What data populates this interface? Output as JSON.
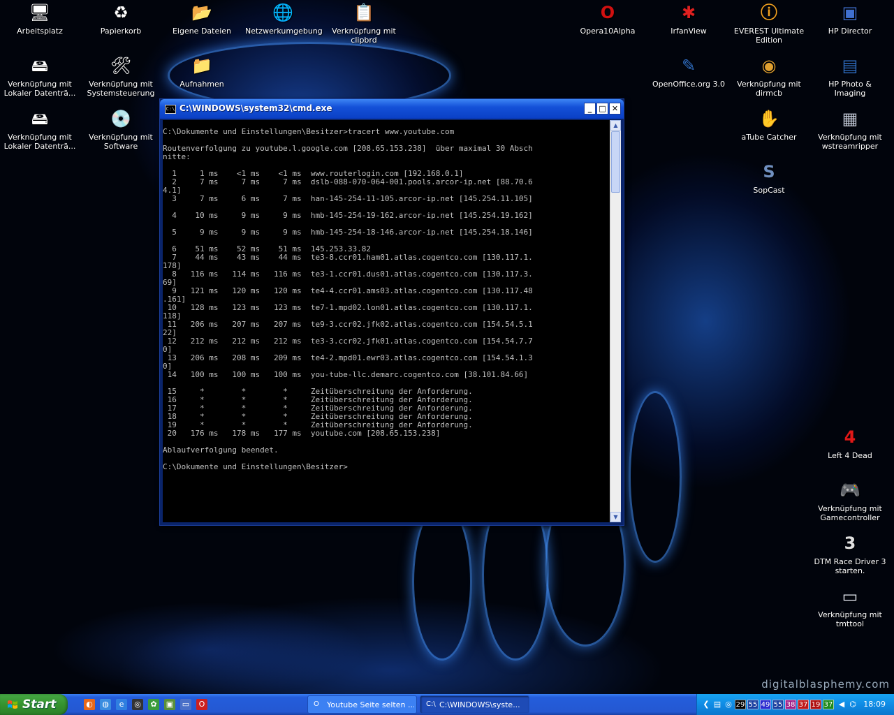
{
  "desktop": {
    "watermark": "digitalblasphemy.com",
    "icons_left": [
      {
        "label": "Arbeitsplatz",
        "icon": "computer-icon",
        "glyph": "🖥"
      },
      {
        "label": "Papierkorb",
        "icon": "recycle-bin-icon",
        "glyph": "♻"
      },
      {
        "label": "Eigene Dateien",
        "icon": "folder-icon",
        "glyph": "📂"
      },
      {
        "label": "Netzwerkumgebung",
        "icon": "network-icon",
        "glyph": "🌐"
      },
      {
        "label": "Verknüpfung mit clipbrd",
        "icon": "clipboard-icon",
        "glyph": "📋"
      },
      {
        "label": "Verknüpfung mit Lokaler Datenträ...",
        "icon": "drive-icon",
        "glyph": "🖴"
      },
      {
        "label": "Verknüpfung mit Systemsteuerung",
        "icon": "control-panel-icon",
        "glyph": "🛠"
      },
      {
        "label": "Aufnahmen",
        "icon": "folder-icon",
        "glyph": "📁"
      },
      {
        "label": "Verknüpfung mit Lokaler Datenträ...",
        "icon": "drive-icon",
        "glyph": "🖴"
      },
      {
        "label": "Verknüpfung mit Software",
        "icon": "software-icon",
        "glyph": "💿"
      }
    ],
    "icons_right": [
      {
        "label": "Opera10Alpha",
        "icon": "opera-icon",
        "glyph": "O"
      },
      {
        "label": "IrfanView",
        "icon": "irfanview-icon",
        "glyph": "✱"
      },
      {
        "label": "EVEREST Ultimate Edition",
        "icon": "everest-icon",
        "glyph": "ⓘ"
      },
      {
        "label": "HP Director",
        "icon": "hp-director-icon",
        "glyph": "▣"
      },
      {
        "label": "OpenOffice.org 3.0",
        "icon": "openoffice-icon",
        "glyph": "✎"
      },
      {
        "label": "Verknüpfung mit dirmcb",
        "icon": "cd-icon",
        "glyph": "◉"
      },
      {
        "label": "HP Photo & Imaging",
        "icon": "hp-photo-icon",
        "glyph": "▤"
      },
      {
        "label": "aTube Catcher",
        "icon": "atube-icon",
        "glyph": "✋"
      },
      {
        "label": "Verknüpfung mit wstreamripper",
        "icon": "streamripper-icon",
        "glyph": "▦"
      },
      {
        "label": "SopCast",
        "icon": "sopcast-icon",
        "glyph": "S"
      },
      {
        "label": "Left 4 Dead",
        "icon": "left4dead-icon",
        "glyph": "4"
      },
      {
        "label": "Verknüpfung mit Gamecontroller",
        "icon": "gamecontroller-icon",
        "glyph": "🎮"
      },
      {
        "label": "DTM Race Driver 3 starten.",
        "icon": "dtm-icon",
        "glyph": "3"
      },
      {
        "label": "Verknüpfung mit tmttool",
        "icon": "window-icon",
        "glyph": "▭"
      }
    ]
  },
  "cmd": {
    "title": "C:\\WINDOWS\\system32\\cmd.exe",
    "app_icon": "C:\\",
    "minimize": "_",
    "maximize": "□",
    "close": "✕",
    "output_lines": [
      "C:\\Dokumente und Einstellungen\\Besitzer>tracert www.youtube.com",
      "",
      "Routenverfolgung zu youtube.l.google.com [208.65.153.238]  über maximal 30 Absch",
      "nitte:",
      "",
      "  1     1 ms    <1 ms    <1 ms  www.routerlogin.com [192.168.0.1]",
      "  2     7 ms     7 ms     7 ms  dslb-088-070-064-001.pools.arcor-ip.net [88.70.6",
      "4.1]",
      "  3     7 ms     6 ms     7 ms  han-145-254-11-105.arcor-ip.net [145.254.11.105]",
      "",
      "  4    10 ms     9 ms     9 ms  hmb-145-254-19-162.arcor-ip.net [145.254.19.162]",
      "",
      "  5     9 ms     9 ms     9 ms  hmb-145-254-18-146.arcor-ip.net [145.254.18.146]",
      "",
      "  6    51 ms    52 ms    51 ms  145.253.33.82",
      "  7    44 ms    43 ms    44 ms  te3-8.ccr01.ham01.atlas.cogentco.com [130.117.1.",
      "178]",
      "  8   116 ms   114 ms   116 ms  te3-1.ccr01.dus01.atlas.cogentco.com [130.117.3.",
      "69]",
      "  9   121 ms   120 ms   120 ms  te4-4.ccr01.ams03.atlas.cogentco.com [130.117.48",
      ".161]",
      " 10   128 ms   123 ms   123 ms  te7-1.mpd02.lon01.atlas.cogentco.com [130.117.1.",
      "118]",
      " 11   206 ms   207 ms   207 ms  te9-3.ccr02.jfk02.atlas.cogentco.com [154.54.5.1",
      "22]",
      " 12   212 ms   212 ms   212 ms  te3-3.ccr02.jfk01.atlas.cogentco.com [154.54.7.7",
      "0]",
      " 13   206 ms   208 ms   209 ms  te4-2.mpd01.ewr03.atlas.cogentco.com [154.54.1.3",
      "0]",
      " 14   100 ms   100 ms   100 ms  you-tube-llc.demarc.cogentco.com [38.101.84.66]",
      "",
      " 15     *        *        *     Zeitüberschreitung der Anforderung.",
      " 16     *        *        *     Zeitüberschreitung der Anforderung.",
      " 17     *        *        *     Zeitüberschreitung der Anforderung.",
      " 18     *        *        *     Zeitüberschreitung der Anforderung.",
      " 19     *        *        *     Zeitüberschreitung der Anforderung.",
      " 20   176 ms   178 ms   177 ms  youtube.com [208.65.153.238]",
      "",
      "Ablaufverfolgung beendet.",
      "",
      "C:\\Dokumente und Einstellungen\\Besitzer>"
    ]
  },
  "taskbar": {
    "start_label": "Start",
    "quick_launch": [
      {
        "icon": "firefox-icon",
        "glyph": "◐",
        "color": "#e8681a"
      },
      {
        "icon": "browser-icon",
        "glyph": "◍",
        "color": "#3a8de0"
      },
      {
        "icon": "internet-explorer-icon",
        "glyph": "e",
        "color": "#2f7fe0"
      },
      {
        "icon": "steam-icon",
        "glyph": "◎",
        "color": "#333333"
      },
      {
        "icon": "msn-icon",
        "glyph": "✿",
        "color": "#3b9b3b"
      },
      {
        "icon": "image-viewer-icon",
        "glyph": "▣",
        "color": "#5a8f3a"
      },
      {
        "icon": "window-icon",
        "glyph": "▭",
        "color": "#4a70c8"
      },
      {
        "icon": "opera-icon",
        "glyph": "O",
        "color": "#cc2020"
      }
    ],
    "tasks": [
      {
        "label": "Youtube Seite selten ...",
        "icon": "opera-icon",
        "glyph": "O",
        "active": false
      },
      {
        "label": "C:\\WINDOWS\\syste...",
        "icon": "cmd-icon",
        "glyph": "C:\\",
        "active": true
      }
    ],
    "tray": {
      "icons": [
        {
          "icon": "tray-arrow-icon",
          "glyph": "❮"
        },
        {
          "icon": "network-tray-icon",
          "glyph": "▤"
        },
        {
          "icon": "steam-tray-icon",
          "glyph": "◎"
        }
      ],
      "numbers": [
        {
          "value": "29",
          "color": "#000000"
        },
        {
          "value": "55",
          "color": "#1a3fa0"
        },
        {
          "value": "49",
          "color": "#2b2bd0"
        },
        {
          "value": "55",
          "color": "#1a3fa0"
        },
        {
          "value": "38",
          "color": "#a0208a"
        },
        {
          "value": "37",
          "color": "#c01818"
        },
        {
          "value": "19",
          "color": "#b01010"
        },
        {
          "value": "37",
          "color": "#1d8a1d"
        }
      ],
      "icons_after": [
        {
          "icon": "volume-icon",
          "glyph": "◀"
        },
        {
          "icon": "tray-app-icon",
          "glyph": "⌬"
        }
      ],
      "clock": "18:09"
    }
  }
}
